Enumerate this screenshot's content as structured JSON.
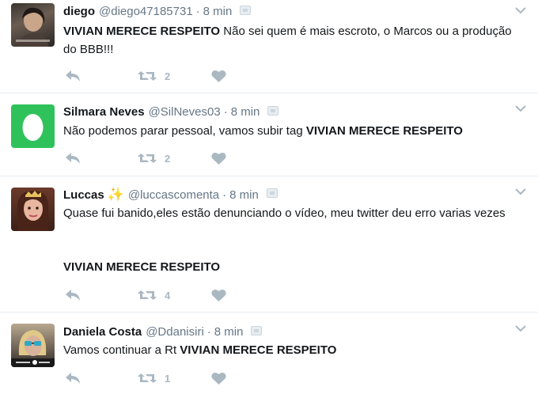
{
  "tweets": [
    {
      "name": "diego",
      "handle": "@diego47185731",
      "separator": "·",
      "time": "8 min",
      "text_bold": "VIVIAN MERECE RESPEITO",
      "text_rest": " Não sei quem é mais escroto, o Marcos ou a produção do BBB!!!",
      "retweets": "2",
      "avatar_icon": "profile-photo"
    },
    {
      "name": "Silmara Neves",
      "handle": "@SilNeves03",
      "separator": "·",
      "time": "8 min",
      "text_pre": "Não podemos parar pessoal, vamos subir tag ",
      "text_bold": "VIVIAN MERECE RESPEITO",
      "retweets": "2",
      "avatar_icon": "default-egg-avatar"
    },
    {
      "name": "Luccas",
      "handle": "@luccascomenta",
      "separator": "·",
      "time": "8 min",
      "text_line": "Quase fui banido,eles estão denunciando o vídeo, meu twitter deu erro varias vezes",
      "text_bold": "VIVIAN MERECE RESPEITO",
      "retweets": "4",
      "avatar_icon": "profile-photo"
    },
    {
      "name": "Daniela Costa",
      "handle": "@Ddanisiri",
      "separator": "·",
      "time": "8 min",
      "text_pre": "Vamos continuar a Rt ",
      "text_bold": "VIVIAN MERECE RESPEITO",
      "retweets": "1",
      "avatar_icon": "profile-photo"
    }
  ],
  "colors": {
    "text": "#14171a",
    "muted": "#657786",
    "icon": "#aab8c2",
    "divider": "#e6ecf0",
    "egg_bg": "#2fc25b"
  }
}
